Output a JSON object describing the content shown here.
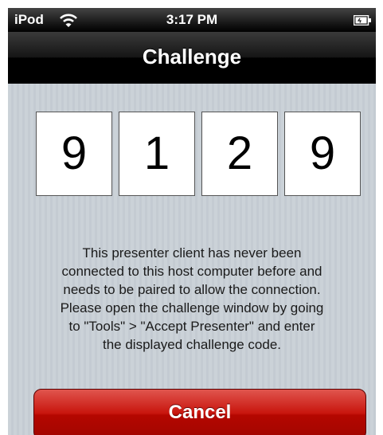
{
  "status_bar": {
    "carrier": "iPod",
    "time": "3:17 PM",
    "wifi_icon": "wifi-icon",
    "battery_icon": "battery-icon"
  },
  "nav": {
    "title": "Challenge"
  },
  "challenge": {
    "digits": [
      "9",
      "1",
      "2",
      "9"
    ]
  },
  "message": {
    "lines": [
      "This presenter client has never been",
      "connected to this host computer before and",
      "needs to be paired to allow the connection.",
      "Please open the challenge window by going",
      "to \"Tools\" > \"Accept Presenter\" and enter",
      "the displayed challenge code."
    ]
  },
  "cancel_button": {
    "label": "Cancel",
    "color": "#c8150d"
  }
}
